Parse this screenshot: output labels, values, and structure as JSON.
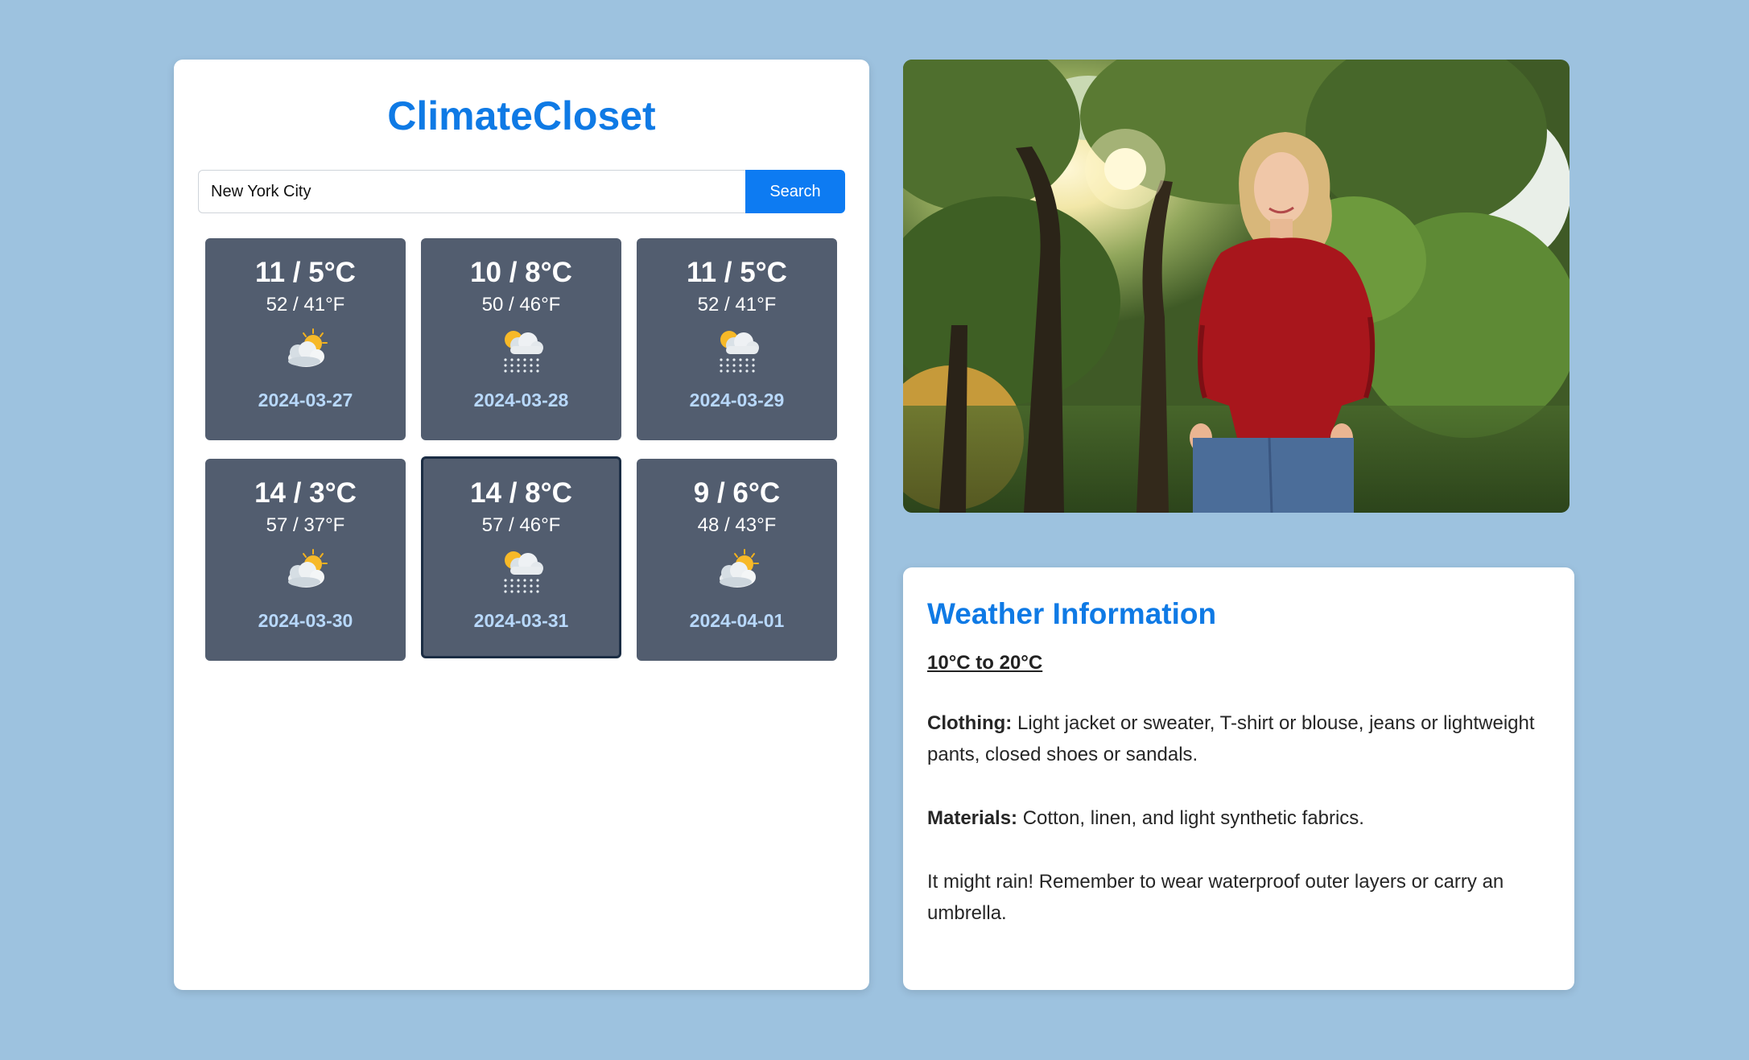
{
  "app": {
    "title": "ClimateCloset"
  },
  "search": {
    "value": "New York City",
    "button_label": "Search"
  },
  "forecast": [
    {
      "celsius": "11 / 5°C",
      "fahrenheit": "52 / 41°F",
      "icon": "partly-cloudy-icon",
      "date": "2024-03-27"
    },
    {
      "celsius": "10 / 8°C",
      "fahrenheit": "50 / 46°F",
      "icon": "rain-icon",
      "date": "2024-03-28"
    },
    {
      "celsius": "11 / 5°C",
      "fahrenheit": "52 / 41°F",
      "icon": "rain-icon",
      "date": "2024-03-29"
    },
    {
      "celsius": "14 / 3°C",
      "fahrenheit": "57 / 37°F",
      "icon": "partly-cloudy-icon",
      "date": "2024-03-30"
    },
    {
      "celsius": "14 / 8°C",
      "fahrenheit": "57 / 46°F",
      "icon": "rain-icon",
      "date": "2024-03-31",
      "selected": true
    },
    {
      "celsius": "9 / 6°C",
      "fahrenheit": "48 / 43°F",
      "icon": "partly-cloudy-icon",
      "date": "2024-04-01"
    }
  ],
  "photo": {
    "description": "woman-in-red-sweater-photo"
  },
  "info": {
    "title": "Weather Information",
    "range": "10°C to 20°C",
    "clothing_label": "Clothing:",
    "clothing_text": " Light jacket or sweater, T-shirt or blouse, jeans or lightweight pants, closed shoes or sandals.",
    "materials_label": "Materials:",
    "materials_text": " Cotton, linen, and light synthetic fabrics.",
    "rain_note": "It might rain! Remember to wear waterproof outer layers or carry an umbrella."
  },
  "colors": {
    "background": "#9dc2df",
    "accent": "#0f7ae5",
    "button": "#0d7bf2",
    "card": "#525d6f",
    "card_date": "#b8d8fb"
  }
}
